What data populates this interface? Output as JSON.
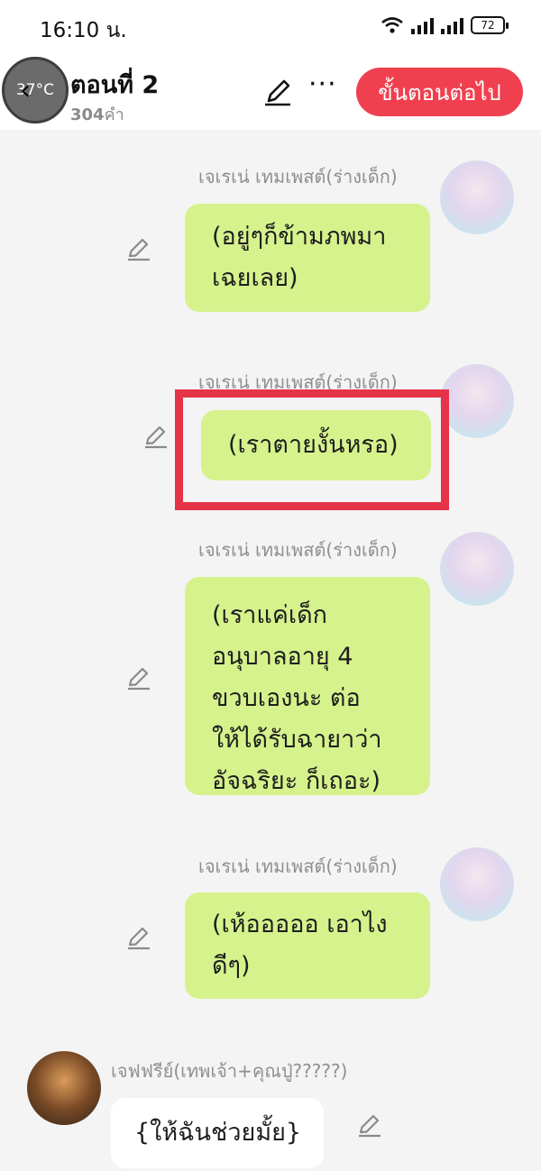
{
  "status_bar": {
    "time": "16:10 น.",
    "battery": "72"
  },
  "header": {
    "temperature_badge": "37°C",
    "chapter_title": "ตอนที่ 2",
    "word_count_number": "304",
    "word_count_unit": "คำ",
    "next_button_label": "ขั้นตอนต่อไป",
    "more_label": "···"
  },
  "messages": [
    {
      "sender": "เจเรเน่ เทมเพสต์(ร่างเด็ก)",
      "lines": [
        "(อยู่ๆก็ข้ามภพมา",
        "เฉยเลย)"
      ]
    },
    {
      "sender": "เจเรเน่ เทมเพสต์(ร่างเด็ก)",
      "lines": [
        "(เราตายงั้นหรอ)"
      ]
    },
    {
      "sender": "เจเรเน่ เทมเพสต์(ร่างเด็ก)",
      "lines": [
        "(เราแค่เด็ก",
        "อนุบาลอายุ 4",
        "ขวบเองนะ ต่อ",
        "ให้ได้รับฉายาว่า",
        "อัจฉริยะ ก็เถอะ)"
      ]
    },
    {
      "sender": "เจเรเน่ เทมเพสต์(ร่างเด็ก)",
      "lines": [
        "(เห้อออออ เอาไง",
        "ดีๆ)"
      ]
    },
    {
      "sender": "เจฟฟรีย์(เทพเจ้า+คุณปู่?????)",
      "lines": [
        "{ให้ฉันช่วยมั้ย}"
      ]
    }
  ],
  "colors": {
    "accent": "#f0404f",
    "bubble_green": "#d6f28c",
    "highlight": "#e53348"
  }
}
